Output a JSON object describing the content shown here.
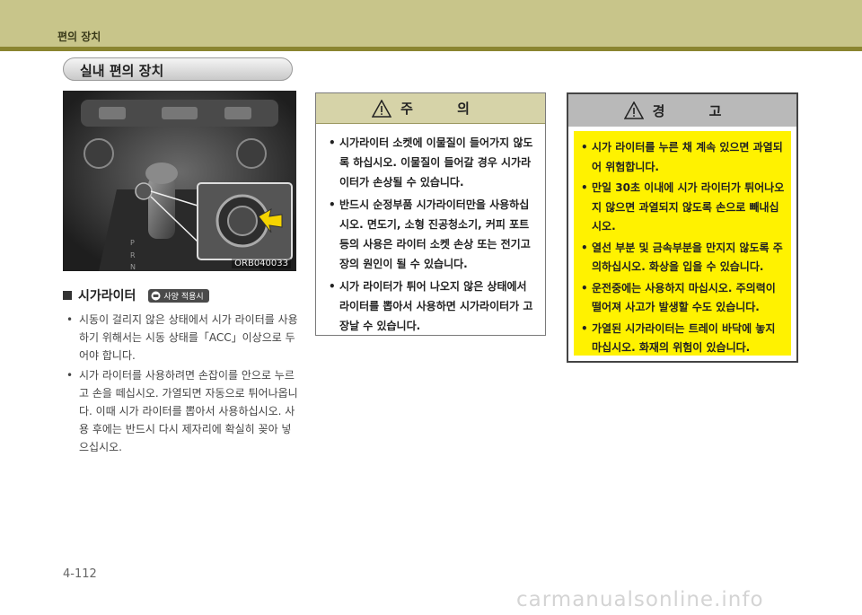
{
  "header": {
    "title": "편의 장치"
  },
  "section": {
    "title": "실내 편의 장치"
  },
  "photo": {
    "code": "ORB040033"
  },
  "cigar": {
    "heading": "시가라이터",
    "badge": "사양 적용시",
    "bullets": [
      "시동이 걸리지 않은 상태에서 시가 라이터를 사용하기 위해서는 시동 상태를「ACC」이상으로 두어야 합니다.",
      "시가 라이터를 사용하려면 손잡이를 안으로 누르고 손을 떼십시오. 가열되면 자동으로 튀어나옵니다. 이때 시가 라이터를 뽑아서 사용하십시오. 사용 후에는 반드시 다시 제자리에 확실히 꽂아 넣으십시오."
    ]
  },
  "caution": {
    "title": "주 의",
    "items": [
      "시가라이터 소켓에 이물질이 들어가지 않도록 하십시오. 이물질이 들어갈 경우 시가라이터가 손상될 수 있습니다.",
      "반드시 순정부품 시가라이터만을 사용하십시오. 면도기, 소형 진공청소기, 커피 포트 등의 사용은 라이터 소켓 손상 또는 전기고장의 원인이 될 수 있습니다.",
      "시가 라이터가 튀어 나오지 않은 상태에서 라이터를 뽑아서 사용하면 시가라이터가 고장날 수 있습니다."
    ]
  },
  "warning": {
    "title": "경 고",
    "items": [
      "시가 라이터를 누른 채 계속 있으면 과열되어 위험합니다.",
      "만일 30초 이내에 시가 라이터가 튀어나오지 않으면 과열되지 않도록 손으로 빼내십시오.",
      "열선 부분 및 금속부분을 만지지 않도록 주의하십시오. 화상을 입을 수 있습니다.",
      "운전중에는 사용하지 마십시오. 주의력이 떨어져 사고가 발생할 수도 있습니다.",
      "가열된 시가라이터는 트레이 바닥에 놓지 마십시오. 화재의 위험이 있습니다."
    ]
  },
  "page": {
    "number": "4-112"
  },
  "watermark": {
    "text": "carmanualsonline.info"
  },
  "colors": {
    "header": "#c8c58a",
    "warning_bg": "#fff200",
    "caution_head": "#d6d3a8"
  }
}
